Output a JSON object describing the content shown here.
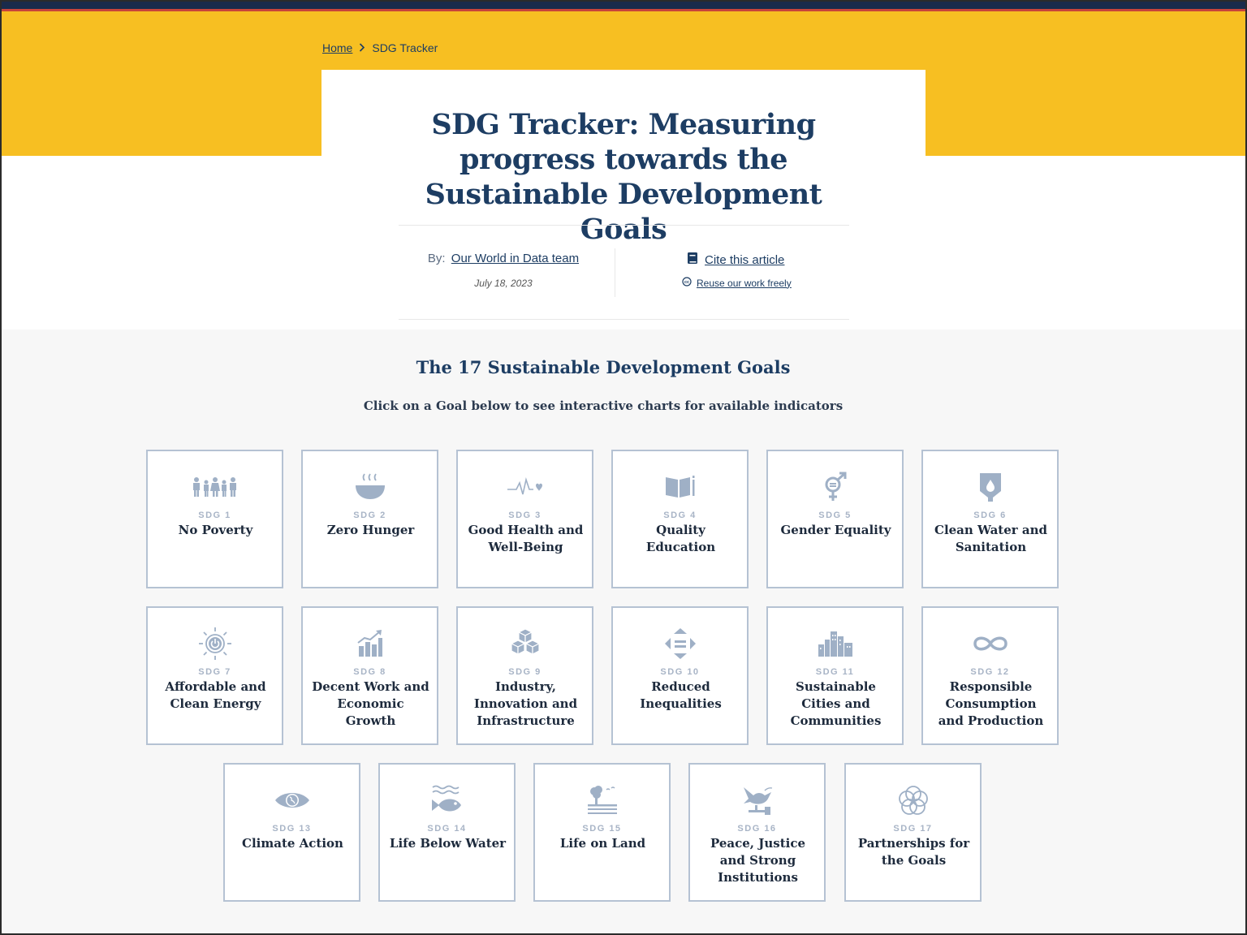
{
  "breadcrumb": {
    "home": "Home",
    "current": "SDG Tracker"
  },
  "article": {
    "title": "SDG Tracker: Measuring progress towards the Sustainable Development Goals",
    "by_label": "By:",
    "author": "Our World in Data team",
    "date": "July 18, 2023",
    "cite_label": "Cite this article",
    "reuse_label": "Reuse our work freely"
  },
  "section": {
    "title": "The 17 Sustainable Development Goals",
    "subtitle": "Click on a Goal below to see interactive charts for available indicators"
  },
  "colors": {
    "accent_yellow": "#f7bf22",
    "navy": "#1d3d63",
    "tile_border": "#b5c2d3",
    "icon_color": "#9fb0c6"
  },
  "goals": [
    {
      "num": "SDG 1",
      "name": "No Poverty",
      "icon": "family-icon"
    },
    {
      "num": "SDG 2",
      "name": "Zero Hunger",
      "icon": "bowl-icon"
    },
    {
      "num": "SDG 3",
      "name": "Good Health and Well-Being",
      "icon": "heartbeat-icon"
    },
    {
      "num": "SDG 4",
      "name": "Quality Education",
      "icon": "book-icon"
    },
    {
      "num": "SDG 5",
      "name": "Gender Equality",
      "icon": "gender-icon"
    },
    {
      "num": "SDG 6",
      "name": "Clean Water and Sanitation",
      "icon": "water-drop-icon"
    },
    {
      "num": "SDG 7",
      "name": "Affordable and Clean Energy",
      "icon": "sun-power-icon"
    },
    {
      "num": "SDG 8",
      "name": "Decent Work and Economic Growth",
      "icon": "growth-chart-icon"
    },
    {
      "num": "SDG 9",
      "name": "Industry, Innovation and Infrastructure",
      "icon": "cubes-icon"
    },
    {
      "num": "SDG 10",
      "name": "Reduced Inequalities",
      "icon": "equality-arrows-icon"
    },
    {
      "num": "SDG 11",
      "name": "Sustainable Cities and Communities",
      "icon": "city-icon"
    },
    {
      "num": "SDG 12",
      "name": "Responsible Consumption and Production",
      "icon": "infinity-icon"
    },
    {
      "num": "SDG 13",
      "name": "Climate Action",
      "icon": "eye-globe-icon"
    },
    {
      "num": "SDG 14",
      "name": "Life Below Water",
      "icon": "fish-icon"
    },
    {
      "num": "SDG 15",
      "name": "Life on Land",
      "icon": "tree-icon"
    },
    {
      "num": "SDG 16",
      "name": "Peace, Justice and Strong Institutions",
      "icon": "dove-icon"
    },
    {
      "num": "SDG 17",
      "name": "Partnerships for the Goals",
      "icon": "rings-icon"
    }
  ]
}
